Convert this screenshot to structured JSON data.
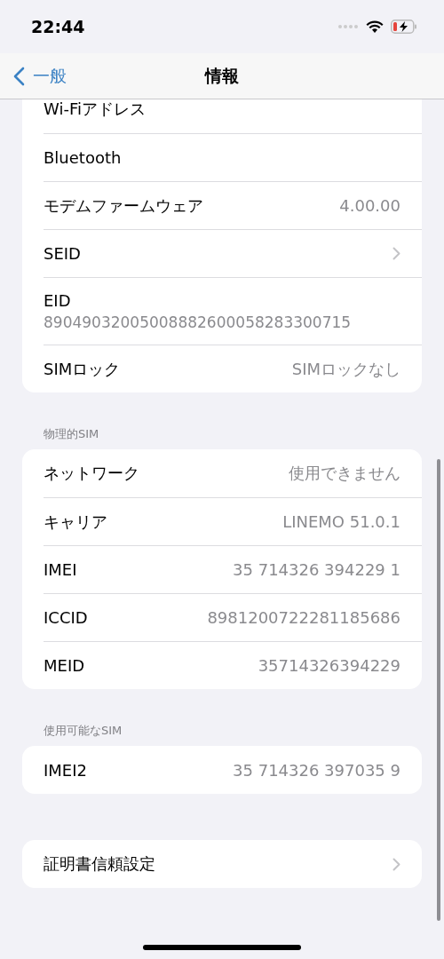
{
  "status_bar": {
    "time": "22:44"
  },
  "nav": {
    "back": "一般",
    "title": "情報"
  },
  "sections": [
    {
      "rows": [
        {
          "kind": "value",
          "label": "Wi-Fiアドレス"
        },
        {
          "kind": "value",
          "label": "Bluetooth"
        },
        {
          "kind": "value",
          "label": "モデムファームウェア",
          "value": "4.00.00"
        },
        {
          "kind": "chevron",
          "label": "SEID"
        },
        {
          "kind": "stacked",
          "label": "EID",
          "value": "89049032005008882600058283300715"
        },
        {
          "kind": "value",
          "label": "SIMロック",
          "value": "SIMロックなし"
        }
      ]
    },
    {
      "header": "物理的SIM",
      "rows": [
        {
          "kind": "value",
          "label": "ネットワーク",
          "value": "使用できません"
        },
        {
          "kind": "value",
          "label": "キャリア",
          "value": "LINEMO 51.0.1"
        },
        {
          "kind": "value",
          "label": "IMEI",
          "value": "35 714326 394229 1"
        },
        {
          "kind": "value",
          "label": "ICCID",
          "value": "8981200722281185686"
        },
        {
          "kind": "value",
          "label": "MEID",
          "value": "35714326394229"
        }
      ]
    },
    {
      "header": "使用可能なSIM",
      "rows": [
        {
          "kind": "value",
          "label": "IMEI2",
          "value": "35 714326 397035 9"
        }
      ]
    },
    {
      "rows": [
        {
          "kind": "chevron",
          "label": "証明書信頼設定"
        }
      ]
    }
  ]
}
